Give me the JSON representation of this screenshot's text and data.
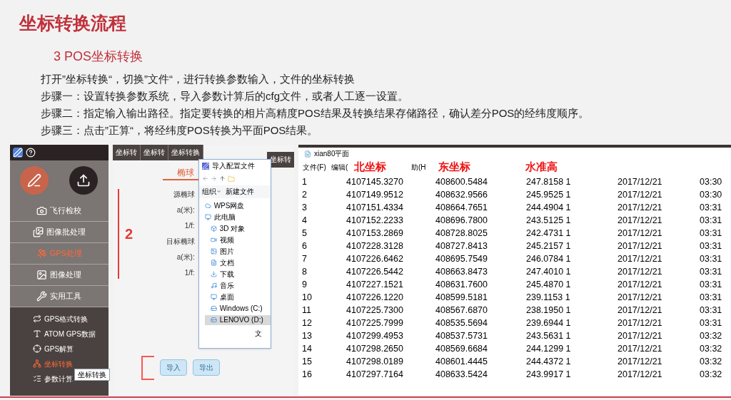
{
  "slide": {
    "title": "坐标转换流程",
    "subtitle": "3 POS坐标转换",
    "paragraphs": [
      "打开”坐标转换“，切换”文件“，进行转换参数输入，文件的坐标转换",
      "步骤一：设置转换参数系统，导入参数计算后的cfg文件，或者人工逐一设置。",
      "步骤二：指定输入输出路径。指定要转换的相片高精度POS结果及转换结果存储路径，确认差分POS的经纬度顺序。",
      "步骤三：点击”正算“，将经纬度POS转换为平面POS结果。"
    ]
  },
  "app_sidebar": {
    "main_items": [
      {
        "label": "飞行检校",
        "selected": false
      },
      {
        "label": "图像批处理",
        "selected": false
      },
      {
        "label": "GPS处理",
        "selected": true
      },
      {
        "label": "图像处理",
        "selected": false
      },
      {
        "label": "实用工具",
        "selected": false
      }
    ],
    "sub_items": [
      {
        "label": "GPS格式转换",
        "selected": false
      },
      {
        "label": "ATOM GPS数据",
        "selected": false
      },
      {
        "label": "GPS解算",
        "selected": false
      },
      {
        "label": "坐标转换",
        "selected": true
      },
      {
        "label": "参数计算",
        "selected": false
      }
    ],
    "tooltip": "坐标转换"
  },
  "converter_window": {
    "window_tabs": [
      "坐标转",
      "坐标转",
      "坐标转换"
    ],
    "right_tab": "坐标转",
    "section_tab": "椭球",
    "labels": [
      "源椭球",
      "a(米):",
      "1/f:",
      "目标椭球",
      "a(米):",
      "1/f:"
    ],
    "annotation": "2",
    "buttons": [
      "导入",
      "导出"
    ]
  },
  "file_dialog": {
    "title": "导入配置文件",
    "toolbar": [
      "组织",
      "新建文件"
    ],
    "tree": [
      {
        "label": "WPS网盘",
        "selected": false
      },
      {
        "label": "此电脑",
        "selected": false
      },
      {
        "label": "3D 对象",
        "selected": false
      },
      {
        "label": "视频",
        "selected": false
      },
      {
        "label": "图片",
        "selected": false
      },
      {
        "label": "文档",
        "selected": false
      },
      {
        "label": "下载",
        "selected": false
      },
      {
        "label": "音乐",
        "selected": false
      },
      {
        "label": "桌面",
        "selected": false
      },
      {
        "label": "Windows (C:)",
        "selected": false
      },
      {
        "label": "LENOVO (D:)",
        "selected": true
      }
    ],
    "footer_text": "文"
  },
  "notepad": {
    "title": "xian80平面",
    "menu": [
      "文件(F)",
      "编辑(",
      "助(H"
    ],
    "annotations": [
      "北坐标",
      "东坐标",
      "水准高"
    ],
    "rows": [
      [
        "1",
        "4107145.3270",
        "408600.5484",
        "247.8158 1",
        "2017/12/21",
        "03:30"
      ],
      [
        "2",
        "4107149.9512",
        "408632.9566",
        "245.9525 1",
        "2017/12/21",
        "03:30"
      ],
      [
        "3",
        "4107151.4334",
        "408664.7651",
        "244.4904 1",
        "2017/12/21",
        "03:31"
      ],
      [
        "4",
        "4107152.2233",
        "408696.7800",
        "243.5125 1",
        "2017/12/21",
        "03:31"
      ],
      [
        "5",
        "4107153.2869",
        "408728.8025",
        "242.4731 1",
        "2017/12/21",
        "03:31"
      ],
      [
        "6",
        "4107228.3128",
        "408727.8413",
        "245.2157 1",
        "2017/12/21",
        "03:31"
      ],
      [
        "7",
        "4107226.6462",
        "408695.7549",
        "246.0784 1",
        "2017/12/21",
        "03:31"
      ],
      [
        "8",
        "4107226.5442",
        "408663.8473",
        "247.4010 1",
        "2017/12/21",
        "03:31"
      ],
      [
        "9",
        "4107227.1521",
        "408631.7600",
        "245.4870 1",
        "2017/12/21",
        "03:31"
      ],
      [
        "10",
        "4107226.1220",
        "408599.5181",
        "239.1153 1",
        "2017/12/21",
        "03:31"
      ],
      [
        "11",
        "4107225.7300",
        "408567.6870",
        "238.1950 1",
        "2017/12/21",
        "03:31"
      ],
      [
        "12",
        "4107225.7999",
        "408535.5694",
        "239.6944 1",
        "2017/12/21",
        "03:31"
      ],
      [
        "13",
        "4107299.4953",
        "408537.5731",
        "243.5631 1",
        "2017/12/21",
        "03:32"
      ],
      [
        "14",
        "4107298.2650",
        "408569.6684",
        "244.1299 1",
        "2017/12/21",
        "03:32"
      ],
      [
        "15",
        "4107298.0189",
        "408601.4445",
        "244.4372 1",
        "2017/12/21",
        "03:32"
      ],
      [
        "16",
        "4107297.7164",
        "408633.5424",
        "243.9917 1",
        "2017/12/21",
        "03:32"
      ]
    ]
  }
}
